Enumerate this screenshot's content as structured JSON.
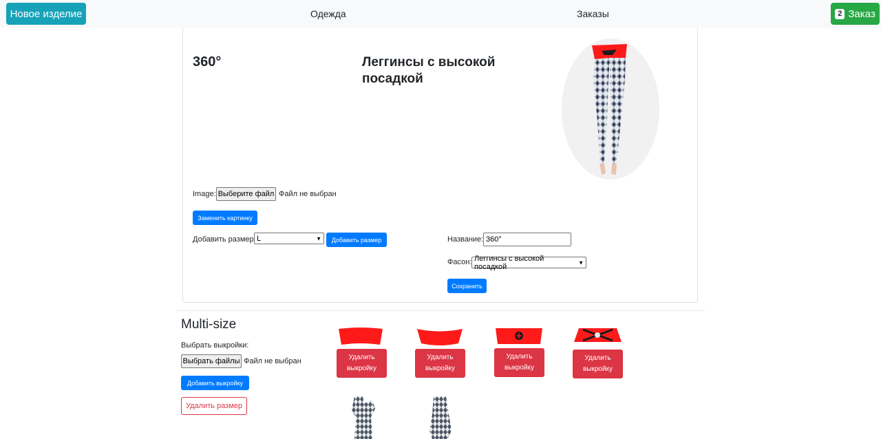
{
  "navbar": {
    "new_item": "Новое изделие",
    "clothing": "Одежда",
    "orders": "Заказы",
    "order_count": "2",
    "order_label": "Заказ"
  },
  "product": {
    "title": "360°",
    "model": "Леггинсы с высокой посадкой"
  },
  "image_form": {
    "label": "Image:",
    "file_button": "Выберите файл",
    "no_file": "Файл не выбран",
    "replace_button": "Заменить картинку"
  },
  "size_form": {
    "label": "Добавить размер:",
    "selected_size": "L",
    "add_button": "Добавить размер"
  },
  "edit_form": {
    "name_label": "Название:",
    "name_value": "360°",
    "style_label": "Фасон:",
    "style_value": "Леггинсы с высокой посадкой",
    "save_button": "Сохранить"
  },
  "multisize": {
    "title": "Multi-size",
    "choose_label": "Выбрать выкройки:",
    "files_button": "Выбрать файлы",
    "no_file": "Файл не выбран",
    "add_pattern_button": "Добавить выкройку",
    "delete_size_button": "Удалить размер",
    "delete_pattern_label": "Удалить выкройку"
  },
  "colors": {
    "primary": "#007bff",
    "info": "#17a2b8",
    "success": "#28a745",
    "danger": "#dc3545",
    "pattern_red": "#ff1a1a"
  }
}
